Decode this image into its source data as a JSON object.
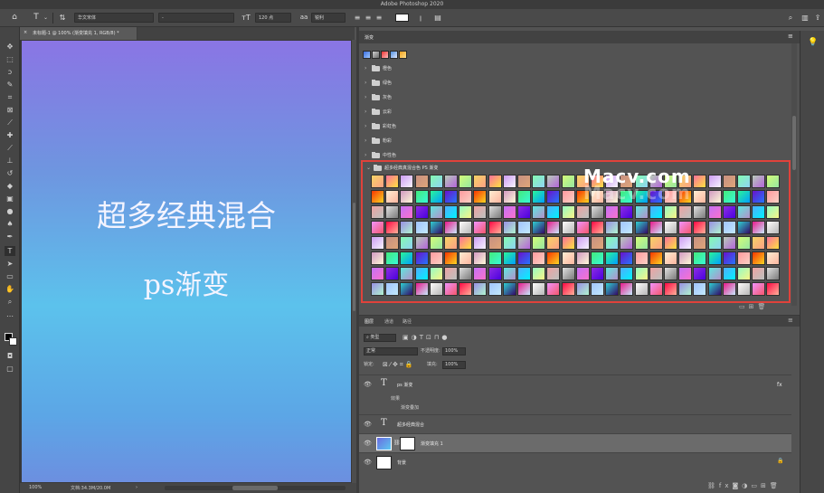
{
  "window": {
    "title": "Adobe Photoshop 2020"
  },
  "options_bar": {
    "font_family": "华文宋体",
    "font_style": "-",
    "font_size": "120 点",
    "anti_alias": "锐利",
    "icons": [
      "home-icon",
      "type-tool-icon",
      "orientation-icon",
      "font-size-icon",
      "align-left-icon",
      "align-center-icon",
      "align-right-icon",
      "color-swatch",
      "warp-text-icon",
      "character-panel-icon",
      "search-icon",
      "workspace-icon",
      "share-icon"
    ]
  },
  "document": {
    "tab_label": "未标题-1 @ 100% (渐变填充 1, RGB/8) *",
    "close_glyph": "×",
    "canvas_text_line1": "超多经典混合",
    "canvas_text_line2": "ps渐变",
    "zoom": "100%",
    "doc_info": "文档:34.3M/20.0M",
    "status_arrow": "›"
  },
  "gradients_panel": {
    "title": "渐变",
    "folders": [
      "橙色",
      "绿色",
      "灰色",
      "云彩",
      "彩虹色",
      "粉彩",
      "中性色"
    ],
    "expanded_folder": "超多经典真混合色 PS 渐变",
    "watermark_text": "Macv.com"
  },
  "layers_panel": {
    "tabs": [
      "图层",
      "通道",
      "路径"
    ],
    "filter_label": "类型",
    "blend_mode": "正常",
    "opacity_label": "不透明度:",
    "opacity_value": "100%",
    "lock_label": "锁定:",
    "fill_label": "填充:",
    "fill_value": "100%",
    "layers": [
      {
        "name": "ps 渐变",
        "kind": "text",
        "effects_label": "效果",
        "effect_name": "渐变叠加",
        "fx": "fx"
      },
      {
        "name": "超多经典混合",
        "kind": "text"
      },
      {
        "name": "渐变填充 1",
        "kind": "fill",
        "selected": true
      },
      {
        "name": "背景",
        "kind": "background",
        "locked": true
      }
    ]
  },
  "tools": [
    "move-tool",
    "marquee-tool",
    "lasso-tool",
    "quick-select-tool",
    "crop-tool",
    "frame-tool",
    "eyedropper-tool",
    "healing-tool",
    "brush-tool",
    "stamp-tool",
    "history-brush-tool",
    "eraser-tool",
    "gradient-tool",
    "blur-tool",
    "dodge-tool",
    "pen-tool",
    "type-tool",
    "path-select-tool",
    "rectangle-tool",
    "hand-tool",
    "zoom-tool"
  ],
  "colors": {
    "highlight_border": "#e0423b",
    "canvas_gradient": [
      "#8a75e4",
      "#6e96e0",
      "#5cc2ec",
      "#5ca6e6",
      "#6c8fe0"
    ]
  }
}
